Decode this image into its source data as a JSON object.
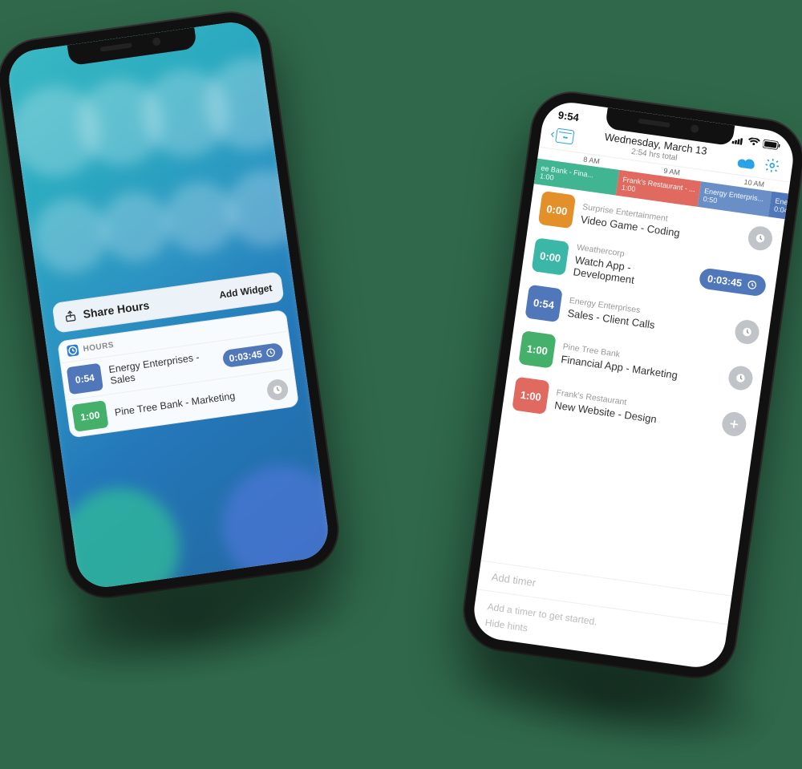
{
  "phone1": {
    "share_label": "Share Hours",
    "add_widget": "Add Widget",
    "widget_title": "HOURS",
    "rows": [
      {
        "duration": "0:54",
        "label": "Energy Enterprises - Sales",
        "color": "#4f77b9",
        "running": true,
        "elapsed": "0:03:45"
      },
      {
        "duration": "1:00",
        "label": "Pine Tree Bank - Marketing",
        "color": "#45b06a",
        "running": false
      }
    ]
  },
  "phone2": {
    "status_time": "9:54",
    "date": "Wednesday, March 13",
    "total": "2:54 hrs total",
    "timeline": {
      "hours": [
        "8 AM",
        "9 AM",
        "10 AM"
      ],
      "segments": [
        {
          "title": "ee Bank - Fina...",
          "dur": "1:00",
          "color": "#41b592",
          "flex": 1
        },
        {
          "title": "Frank's Restaurant - ...",
          "dur": "1:00",
          "color": "#e06a60",
          "flex": 1
        },
        {
          "title": "Energy Enterpris...",
          "dur": "0:50",
          "color": "#6a8fc6",
          "flex": 0.85
        },
        {
          "title": "Energ...",
          "dur": "0:04",
          "color": "#4f77b9",
          "flex": 0.1
        }
      ]
    },
    "items": [
      {
        "color": "#e3902b",
        "dur": "0:00",
        "client": "Surprise Entertainment",
        "task": "Video Game - Coding",
        "running": false
      },
      {
        "color": "#3ab7a6",
        "dur": "0:00",
        "client": "Weathercorp",
        "task": "Watch App - Development",
        "running": true,
        "elapsed": "0:03:45"
      },
      {
        "color": "#4f77b9",
        "dur": "0:54",
        "client": "Energy Enterprises",
        "task": "Sales - Client Calls",
        "running": false
      },
      {
        "color": "#45b06a",
        "dur": "1:00",
        "client": "Pine Tree Bank",
        "task": "Financial App - Marketing",
        "running": false
      },
      {
        "color": "#e06a60",
        "dur": "1:00",
        "client": "Frank's Restaurant",
        "task": "New Website - Design",
        "running": false,
        "add": true
      }
    ],
    "add_timer": "Add timer",
    "hint1": "Add a timer to get started.",
    "hint2": "Hide hints"
  }
}
